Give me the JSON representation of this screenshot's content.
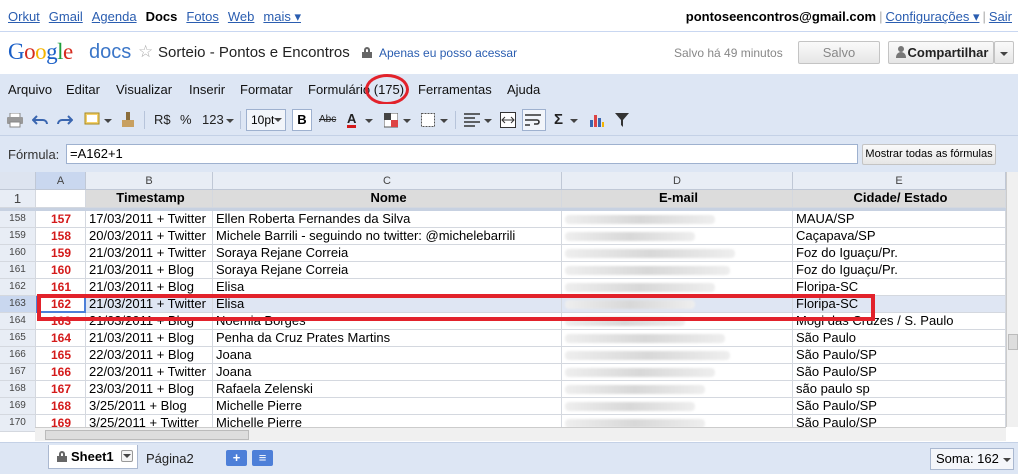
{
  "gbar": {
    "links": [
      "Orkut",
      "Gmail",
      "Agenda",
      "Docs",
      "Fotos",
      "Web",
      "mais ▾"
    ],
    "active": "Docs",
    "email": "pontoseencontros@gmail.com",
    "settings": "Configurações ▾",
    "signout": "Sair"
  },
  "header": {
    "logo": "Google",
    "product": "docs",
    "title": "Sorteio - Pontos e Encontros",
    "privacy": "Apenas eu posso acessar",
    "saved_status": "Salvo há 49 minutos",
    "saved_button": "Salvo",
    "share_button": "Compartilhar"
  },
  "menu": [
    "Arquivo",
    "Editar",
    "Visualizar",
    "Inserir",
    "Formatar",
    "Formulário (175)",
    "Ferramentas",
    "Ajuda"
  ],
  "toolbar": {
    "currency": "R$",
    "percent": "%",
    "number_format": "123",
    "font_size": "10pt",
    "bold": "B",
    "strike": "Abc",
    "text_color": "A",
    "sum": "Σ"
  },
  "formula": {
    "label": "Fórmula:",
    "value": "=A162+1",
    "show_all": "Mostrar todas as fórmulas"
  },
  "grid": {
    "columns": [
      "A",
      "B",
      "C",
      "D",
      "E"
    ],
    "header_row_num": "1",
    "headers": [
      "",
      "Timestamp",
      "Nome",
      "E-mail",
      "Cidade/ Estado"
    ],
    "rows": [
      {
        "n": "158",
        "a": "157",
        "b": "17/03/2011 + Twitter",
        "c": "Ellen Roberta Fernandes da Silva",
        "e": "MAUA/SP"
      },
      {
        "n": "159",
        "a": "158",
        "b": "20/03/2011 + Twitter",
        "c": "Michele Barrili - seguindo no twitter: @michelebarrili",
        "e": "Caçapava/SP"
      },
      {
        "n": "160",
        "a": "159",
        "b": "21/03/2011 + Twitter",
        "c": "Soraya Rejane Correia",
        "e": "Foz do Iguaçu/Pr."
      },
      {
        "n": "161",
        "a": "160",
        "b": "21/03/2011 + Blog",
        "c": "Soraya Rejane Correia",
        "e": "Foz do Iguaçu/Pr."
      },
      {
        "n": "162",
        "a": "161",
        "b": "21/03/2011 + Blog",
        "c": "Elisa",
        "e": "Floripa-SC"
      },
      {
        "n": "163",
        "a": "162",
        "b": "21/03/2011 + Twitter",
        "c": "Elisa",
        "e": "Floripa-SC"
      },
      {
        "n": "164",
        "a": "163",
        "b": "21/03/2011 + Blog",
        "c": "Noemia Borges",
        "e": "Mogi das Cruzes / S. Paulo"
      },
      {
        "n": "165",
        "a": "164",
        "b": "21/03/2011 + Blog",
        "c": "Penha da Cruz Prates Martins",
        "e": "São Paulo"
      },
      {
        "n": "166",
        "a": "165",
        "b": "22/03/2011 + Blog",
        "c": "Joana",
        "e": "São Paulo/SP"
      },
      {
        "n": "167",
        "a": "166",
        "b": "22/03/2011 + Twitter",
        "c": "Joana",
        "e": "São Paulo/SP"
      },
      {
        "n": "168",
        "a": "167",
        "b": "23/03/2011 + Blog",
        "c": "Rafaela Zelenski",
        "e": "são paulo sp"
      },
      {
        "n": "169",
        "a": "168",
        "b": "3/25/2011 + Blog",
        "c": "Michelle Pierre",
        "e": "São Paulo/SP"
      },
      {
        "n": "170",
        "a": "169",
        "b": "3/25/2011 + Twitter",
        "c": "Michelle Pierre",
        "e": "São Paulo/SP"
      }
    ]
  },
  "sheets": {
    "active": "Sheet1",
    "other": "Página2",
    "add": "+",
    "list": "≡",
    "sum_label": "Soma: 162"
  },
  "colors": {
    "accent": "#4d7fd8",
    "highlight": "#e2222b",
    "toolbar_bg": "#dde6f4"
  }
}
